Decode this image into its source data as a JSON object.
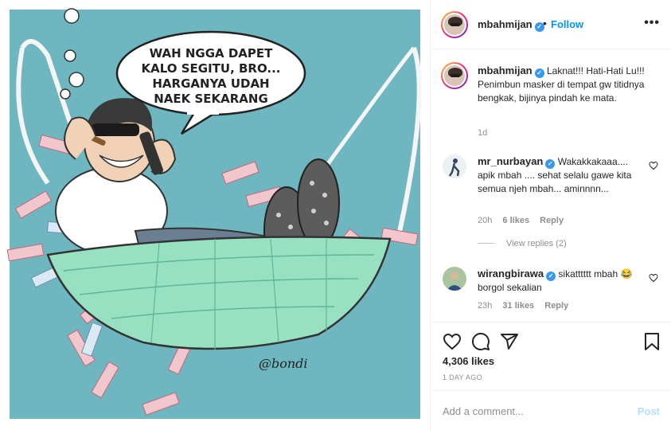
{
  "post": {
    "artwork": {
      "speech_bubble": [
        "WAH NGGA DAPET",
        "KALO SEGITU, BRO...",
        "HARGANYA UDAH",
        "NAEK SEKARANG"
      ],
      "signature": "@bondi"
    }
  },
  "header": {
    "username": "mbahmijan",
    "follow_label": "Follow",
    "separator": "•"
  },
  "caption": {
    "username": "mbahmijan",
    "text": "Laknat!!! Hati-Hati Lu!!! Penimbun masker di tempat gw titidnya bengkak, bijinya pindah ke mata.",
    "time": "1d"
  },
  "comments": [
    {
      "username": "mr_nurbayan",
      "text": "Wakakkakaaa.... apik mbah .... sehat selalu gawe kita semua njeh mbah... aminnnn...",
      "time": "20h",
      "likes": "6 likes",
      "reply": "Reply",
      "view_replies": "View replies (2)"
    },
    {
      "username": "wirangbirawa",
      "text": "sikatttttt mbah 😂 borgol sekalian",
      "time": "23h",
      "likes": "31 likes",
      "reply": "Reply"
    }
  ],
  "stats": {
    "likes": "4,306 likes",
    "posted": "1 DAY AGO"
  },
  "add_comment": {
    "placeholder": "Add a comment...",
    "post_label": "Post"
  },
  "colors": {
    "accent": "#0095f6",
    "verified": "#3897f0",
    "art_background": "#6fb7c0",
    "muted": "#8e8e8e"
  },
  "icons": [
    "verified-badge-icon",
    "more-options-icon",
    "heart-icon",
    "comment-icon",
    "share-icon",
    "bookmark-icon"
  ]
}
